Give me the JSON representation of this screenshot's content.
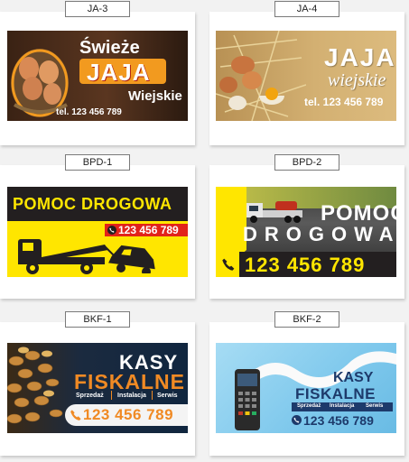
{
  "items": [
    {
      "code": "JA-3",
      "line1": "Świeże",
      "line2": "JAJA",
      "line3": "Wiejskie",
      "phone": "tel. 123 456 789"
    },
    {
      "code": "JA-4",
      "line1": "JAJA",
      "line2": "wiejskie",
      "phone": "tel. 123 456 789"
    },
    {
      "code": "BPD-1",
      "line1": "POMOC DROGOWA",
      "phone": "123 456 789"
    },
    {
      "code": "BPD-2",
      "line1": "POMOC",
      "line2": "DROGOWA",
      "phone": "123 456 789"
    },
    {
      "code": "BKF-1",
      "line1": "KASY",
      "line2": "FISKALNE",
      "services": [
        "Sprzedaż",
        "Instalacja",
        "Serwis"
      ],
      "phone": "123 456 789"
    },
    {
      "code": "BKF-2",
      "line1": "KASY",
      "line2": "FISKALNE",
      "services": [
        "Sprzedaż",
        "Instalacja",
        "Serwis"
      ],
      "phone": "123 456 789"
    }
  ],
  "colors": {
    "page_bg": "#f2f2f2",
    "ja3_bg": "#4a2c1a",
    "ja3_accent": "#f29a1f",
    "ja4_bg": "#d8b474",
    "bpd_yellow": "#ffe600",
    "bpd_dark": "#231f20",
    "bpd_red": "#e2231a",
    "bkf1_bg": "#10263f",
    "bkf_orange": "#f08a24",
    "bkf2_bg": "#7ec8ec",
    "bkf2_navy": "#1d3a6b"
  },
  "icons": [
    "phone-icon",
    "tow-truck-icon",
    "car-icon",
    "payment-terminal-icon",
    "coins-image",
    "eggs-image",
    "straw-image",
    "truck-image"
  ]
}
